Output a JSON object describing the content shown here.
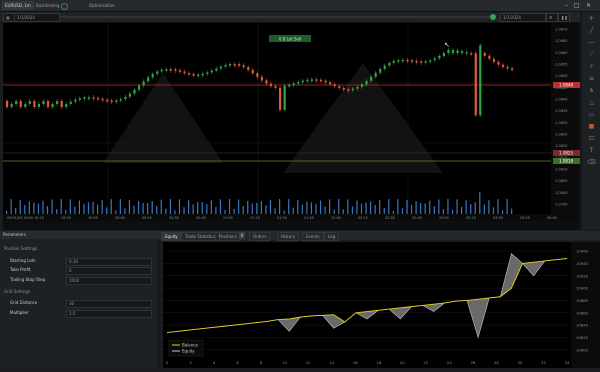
{
  "topbar": {
    "tabs": [
      "EURUSD, 1m",
      "Backtesting",
      "Optimization"
    ]
  },
  "chart_toolbar": {
    "start_date": "1/1/2024",
    "end_date": "1/1/2024",
    "current_date": "1/1/2024",
    "scroll_label": "Scroll",
    "zoom_value": "1"
  },
  "price_chart": {
    "top_label": "0.8 Lot Sell",
    "y_ticks": [
      "1.0870",
      "1.0865",
      "1.0860",
      "1.0855",
      "1.0850",
      "1.0845",
      "1.0840",
      "1.0835",
      "1.0830",
      "1.0825",
      "1.0820",
      "1.0815",
      "1.0810",
      "1.0805",
      "1.0800",
      "1.0795"
    ],
    "red_line_label": "1.0848",
    "green_line_label": "1.0818",
    "price_tag_label": "1.0825",
    "x_ticks": [
      "03/01/24 19:00",
      "19:15",
      "19:30",
      "19:45",
      "20:00",
      "20:15",
      "20:30",
      "20:45",
      "21:00",
      "21:15",
      "21:30",
      "21:45",
      "22:00",
      "22:15",
      "22:30",
      "22:45",
      "23:00",
      "23:15",
      "23:30",
      "23:45",
      "00:00"
    ]
  },
  "param_panel": {
    "title": "Parameters",
    "section1": "Position Settings",
    "rows1": [
      {
        "label": "Starting Lots",
        "value": "0.10"
      },
      {
        "label": "Take Profit",
        "value": "0"
      },
      {
        "label": "Trailing Stop Step",
        "value": "1000"
      }
    ],
    "section2": "Grid Settings",
    "rows2": [
      {
        "label": "Grid Distance",
        "value": "30"
      },
      {
        "label": "Multiplier",
        "value": "1.5"
      }
    ]
  },
  "results": {
    "tabs": [
      "Equity",
      "Trade Statistics",
      "Positions",
      "Orders",
      "History",
      "Events",
      "Log"
    ],
    "orders_count": "0",
    "legend": [
      "Balance",
      "Equity"
    ],
    "colors": {
      "balance": "#e6d21a",
      "equity": "#c8c8c8"
    }
  },
  "chart_data": {
    "type": "line",
    "y_ticks": [
      "10960",
      "10940",
      "10920",
      "10900",
      "10880",
      "10860",
      "10840",
      "10820",
      "10800"
    ],
    "x_ticks": [
      "0",
      "2",
      "4",
      "6",
      "8",
      "10",
      "12",
      "14",
      "16",
      "18",
      "20",
      "22",
      "24",
      "26",
      "28",
      "30",
      "32",
      "34"
    ],
    "series": [
      {
        "name": "Balance",
        "values": [
          10828,
          10830,
          10832,
          10834,
          10836,
          10838,
          10840,
          10842,
          10844,
          10846,
          10849,
          10850,
          10853,
          10855,
          10856,
          10857,
          10845,
          10860,
          10862,
          10864,
          10866,
          10868,
          10870,
          10872,
          10874,
          10876,
          10879,
          10880,
          10882,
          10884,
          10886,
          10900,
          10940,
          10942,
          10944,
          10946,
          10948
        ]
      },
      {
        "name": "Equity",
        "values": [
          10828,
          10830,
          10832,
          10834,
          10836,
          10838,
          10840,
          10842,
          10844,
          10846,
          10849,
          10830,
          10853,
          10855,
          10856,
          10835,
          10845,
          10860,
          10850,
          10864,
          10866,
          10850,
          10870,
          10872,
          10862,
          10876,
          10879,
          10880,
          10820,
          10884,
          10886,
          10956,
          10940,
          10920,
          10944,
          10946,
          10948
        ]
      }
    ],
    "ylim": [
      10790,
      10965
    ]
  }
}
